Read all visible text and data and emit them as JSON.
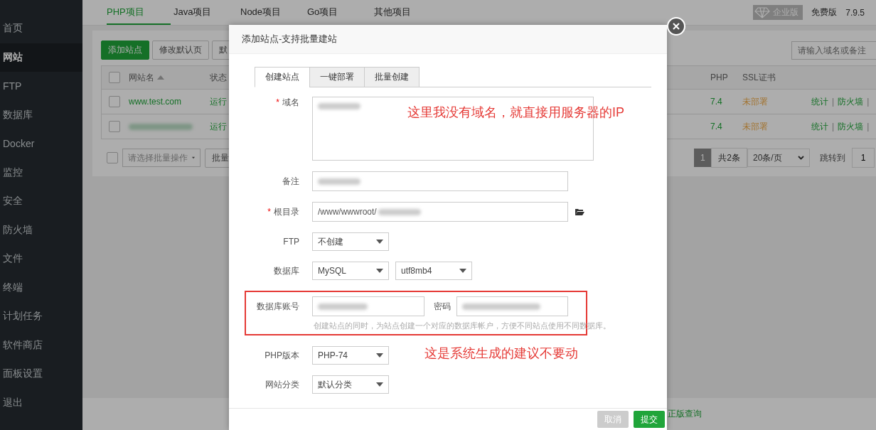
{
  "sidebar": {
    "items": [
      {
        "label": "首页",
        "selected": false
      },
      {
        "label": "网站",
        "selected": true
      },
      {
        "label": "FTP",
        "selected": false
      },
      {
        "label": "数据库",
        "selected": false
      },
      {
        "label": "Docker",
        "selected": false
      },
      {
        "label": "监控",
        "selected": false
      },
      {
        "label": "安全",
        "selected": false
      },
      {
        "label": "防火墙",
        "selected": false
      },
      {
        "label": "文件",
        "selected": false
      },
      {
        "label": "终端",
        "selected": false
      },
      {
        "label": "计划任务",
        "selected": false
      },
      {
        "label": "软件商店",
        "selected": false
      },
      {
        "label": "面板设置",
        "selected": false
      },
      {
        "label": "退出",
        "selected": false
      }
    ]
  },
  "project_tabs": [
    {
      "label": "PHP项目",
      "selected": true
    },
    {
      "label": "Java项目",
      "selected": false
    },
    {
      "label": "Node项目",
      "selected": false
    },
    {
      "label": "Go项目",
      "selected": false
    },
    {
      "label": "其他项目",
      "selected": false
    }
  ],
  "edition": {
    "badge": "企业版",
    "label": "免费版",
    "version": "7.9.5"
  },
  "toolbar": {
    "buttons": [
      {
        "label": "添加站点",
        "kind": "primary"
      },
      {
        "label": "修改默认页",
        "kind": "default"
      },
      {
        "label": "默",
        "kind": "default"
      }
    ],
    "search": {
      "placeholder": "请输入域名或备注"
    }
  },
  "site_table": {
    "all_checked": false,
    "columns": [
      {
        "label": "网站名",
        "sortable": true
      },
      {
        "label": "状态"
      },
      {
        "label": "PHP"
      },
      {
        "label": "SSL证书"
      }
    ],
    "rows": [
      {
        "checked": false,
        "name": "www.test.com",
        "status": "运行",
        "php": "7.4",
        "ssl": "未部署",
        "actions": [
          {
            "kind": "link",
            "label": "统计"
          },
          {
            "kind": "separator",
            "label": "|"
          },
          {
            "kind": "link",
            "label": "防火墙"
          },
          {
            "kind": "separator",
            "label": "|"
          }
        ]
      },
      {
        "checked": false,
        "redacted": true,
        "status": "运行",
        "php": "7.4",
        "ssl": "未部署",
        "actions": [
          {
            "kind": "link",
            "label": "统计"
          },
          {
            "kind": "separator",
            "label": "|"
          },
          {
            "kind": "link",
            "label": "防火墙"
          },
          {
            "kind": "separator",
            "label": "|"
          }
        ]
      }
    ]
  },
  "batch": {
    "checked": false,
    "placeholder": "请选择批量操作",
    "button": "批量"
  },
  "pagination": {
    "current": "1",
    "total": "共2条",
    "page_size": "20条/页",
    "jump_label": "跳转到",
    "jump_value": "1"
  },
  "footer_link": "正版查询",
  "dialog": {
    "title": "添加站点-支持批量建站",
    "tabs": [
      {
        "label": "创建站点",
        "selected": true
      },
      {
        "label": "一键部署",
        "selected": false
      },
      {
        "label": "批量创建",
        "selected": false
      }
    ],
    "fields": [
      {
        "kind": "textarea",
        "label": "域名",
        "marker": "*",
        "redacted": true,
        "note": "这里我没有域名，就直接用服务器的IP"
      },
      {
        "kind": "input",
        "label": "备注",
        "redacted": true
      },
      {
        "kind": "path",
        "label": "根目录",
        "marker": "*",
        "value": "/www/wwwroot/",
        "redacted": true
      },
      {
        "kind": "select",
        "label": "FTP",
        "options": [
          "不创建"
        ]
      },
      {
        "kind": "select",
        "label": "数据库",
        "options": [
          "MySQL",
          "utf8mb4"
        ]
      },
      {
        "kind": "credentials",
        "label": "数据库账号",
        "password_label": "密码",
        "redacted": true,
        "highlighted": true,
        "hint": "创建站点的同时，为站点创建一个对应的数据库帐户，方便不同站点使用不同数据库。",
        "note": "这是系统生成的建议不要动"
      },
      {
        "kind": "select",
        "label": "PHP版本",
        "options": [
          "PHP-74"
        ]
      },
      {
        "kind": "select",
        "label": "网站分类",
        "options": [
          "默认分类"
        ]
      }
    ],
    "buttons": [
      {
        "label": "取消",
        "kind": "cancel"
      },
      {
        "label": "提交",
        "kind": "submit"
      }
    ]
  }
}
